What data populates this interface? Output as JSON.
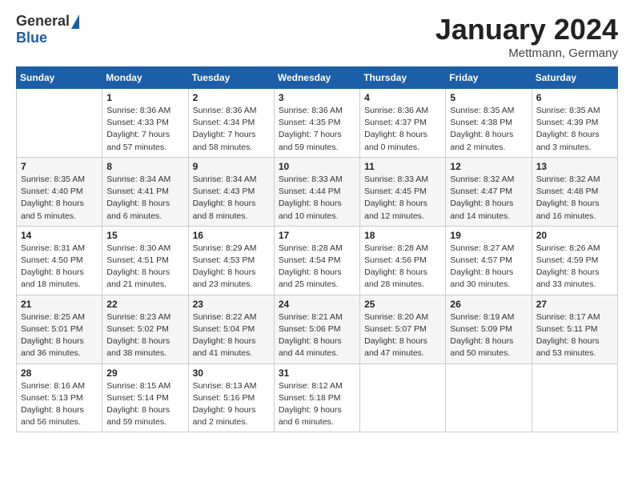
{
  "logo": {
    "general": "General",
    "blue": "Blue"
  },
  "header": {
    "month": "January 2024",
    "location": "Mettmann, Germany"
  },
  "weekdays": [
    "Sunday",
    "Monday",
    "Tuesday",
    "Wednesday",
    "Thursday",
    "Friday",
    "Saturday"
  ],
  "weeks": [
    [
      {
        "day": "",
        "sunrise": "",
        "sunset": "",
        "daylight": ""
      },
      {
        "day": "1",
        "sunrise": "Sunrise: 8:36 AM",
        "sunset": "Sunset: 4:33 PM",
        "daylight": "Daylight: 7 hours and 57 minutes."
      },
      {
        "day": "2",
        "sunrise": "Sunrise: 8:36 AM",
        "sunset": "Sunset: 4:34 PM",
        "daylight": "Daylight: 7 hours and 58 minutes."
      },
      {
        "day": "3",
        "sunrise": "Sunrise: 8:36 AM",
        "sunset": "Sunset: 4:35 PM",
        "daylight": "Daylight: 7 hours and 59 minutes."
      },
      {
        "day": "4",
        "sunrise": "Sunrise: 8:36 AM",
        "sunset": "Sunset: 4:37 PM",
        "daylight": "Daylight: 8 hours and 0 minutes."
      },
      {
        "day": "5",
        "sunrise": "Sunrise: 8:35 AM",
        "sunset": "Sunset: 4:38 PM",
        "daylight": "Daylight: 8 hours and 2 minutes."
      },
      {
        "day": "6",
        "sunrise": "Sunrise: 8:35 AM",
        "sunset": "Sunset: 4:39 PM",
        "daylight": "Daylight: 8 hours and 3 minutes."
      }
    ],
    [
      {
        "day": "7",
        "sunrise": "Sunrise: 8:35 AM",
        "sunset": "Sunset: 4:40 PM",
        "daylight": "Daylight: 8 hours and 5 minutes."
      },
      {
        "day": "8",
        "sunrise": "Sunrise: 8:34 AM",
        "sunset": "Sunset: 4:41 PM",
        "daylight": "Daylight: 8 hours and 6 minutes."
      },
      {
        "day": "9",
        "sunrise": "Sunrise: 8:34 AM",
        "sunset": "Sunset: 4:43 PM",
        "daylight": "Daylight: 8 hours and 8 minutes."
      },
      {
        "day": "10",
        "sunrise": "Sunrise: 8:33 AM",
        "sunset": "Sunset: 4:44 PM",
        "daylight": "Daylight: 8 hours and 10 minutes."
      },
      {
        "day": "11",
        "sunrise": "Sunrise: 8:33 AM",
        "sunset": "Sunset: 4:45 PM",
        "daylight": "Daylight: 8 hours and 12 minutes."
      },
      {
        "day": "12",
        "sunrise": "Sunrise: 8:32 AM",
        "sunset": "Sunset: 4:47 PM",
        "daylight": "Daylight: 8 hours and 14 minutes."
      },
      {
        "day": "13",
        "sunrise": "Sunrise: 8:32 AM",
        "sunset": "Sunset: 4:48 PM",
        "daylight": "Daylight: 8 hours and 16 minutes."
      }
    ],
    [
      {
        "day": "14",
        "sunrise": "Sunrise: 8:31 AM",
        "sunset": "Sunset: 4:50 PM",
        "daylight": "Daylight: 8 hours and 18 minutes."
      },
      {
        "day": "15",
        "sunrise": "Sunrise: 8:30 AM",
        "sunset": "Sunset: 4:51 PM",
        "daylight": "Daylight: 8 hours and 21 minutes."
      },
      {
        "day": "16",
        "sunrise": "Sunrise: 8:29 AM",
        "sunset": "Sunset: 4:53 PM",
        "daylight": "Daylight: 8 hours and 23 minutes."
      },
      {
        "day": "17",
        "sunrise": "Sunrise: 8:28 AM",
        "sunset": "Sunset: 4:54 PM",
        "daylight": "Daylight: 8 hours and 25 minutes."
      },
      {
        "day": "18",
        "sunrise": "Sunrise: 8:28 AM",
        "sunset": "Sunset: 4:56 PM",
        "daylight": "Daylight: 8 hours and 28 minutes."
      },
      {
        "day": "19",
        "sunrise": "Sunrise: 8:27 AM",
        "sunset": "Sunset: 4:57 PM",
        "daylight": "Daylight: 8 hours and 30 minutes."
      },
      {
        "day": "20",
        "sunrise": "Sunrise: 8:26 AM",
        "sunset": "Sunset: 4:59 PM",
        "daylight": "Daylight: 8 hours and 33 minutes."
      }
    ],
    [
      {
        "day": "21",
        "sunrise": "Sunrise: 8:25 AM",
        "sunset": "Sunset: 5:01 PM",
        "daylight": "Daylight: 8 hours and 36 minutes."
      },
      {
        "day": "22",
        "sunrise": "Sunrise: 8:23 AM",
        "sunset": "Sunset: 5:02 PM",
        "daylight": "Daylight: 8 hours and 38 minutes."
      },
      {
        "day": "23",
        "sunrise": "Sunrise: 8:22 AM",
        "sunset": "Sunset: 5:04 PM",
        "daylight": "Daylight: 8 hours and 41 minutes."
      },
      {
        "day": "24",
        "sunrise": "Sunrise: 8:21 AM",
        "sunset": "Sunset: 5:06 PM",
        "daylight": "Daylight: 8 hours and 44 minutes."
      },
      {
        "day": "25",
        "sunrise": "Sunrise: 8:20 AM",
        "sunset": "Sunset: 5:07 PM",
        "daylight": "Daylight: 8 hours and 47 minutes."
      },
      {
        "day": "26",
        "sunrise": "Sunrise: 8:19 AM",
        "sunset": "Sunset: 5:09 PM",
        "daylight": "Daylight: 8 hours and 50 minutes."
      },
      {
        "day": "27",
        "sunrise": "Sunrise: 8:17 AM",
        "sunset": "Sunset: 5:11 PM",
        "daylight": "Daylight: 8 hours and 53 minutes."
      }
    ],
    [
      {
        "day": "28",
        "sunrise": "Sunrise: 8:16 AM",
        "sunset": "Sunset: 5:13 PM",
        "daylight": "Daylight: 8 hours and 56 minutes."
      },
      {
        "day": "29",
        "sunrise": "Sunrise: 8:15 AM",
        "sunset": "Sunset: 5:14 PM",
        "daylight": "Daylight: 8 hours and 59 minutes."
      },
      {
        "day": "30",
        "sunrise": "Sunrise: 8:13 AM",
        "sunset": "Sunset: 5:16 PM",
        "daylight": "Daylight: 9 hours and 2 minutes."
      },
      {
        "day": "31",
        "sunrise": "Sunrise: 8:12 AM",
        "sunset": "Sunset: 5:18 PM",
        "daylight": "Daylight: 9 hours and 6 minutes."
      },
      {
        "day": "",
        "sunrise": "",
        "sunset": "",
        "daylight": ""
      },
      {
        "day": "",
        "sunrise": "",
        "sunset": "",
        "daylight": ""
      },
      {
        "day": "",
        "sunrise": "",
        "sunset": "",
        "daylight": ""
      }
    ]
  ]
}
